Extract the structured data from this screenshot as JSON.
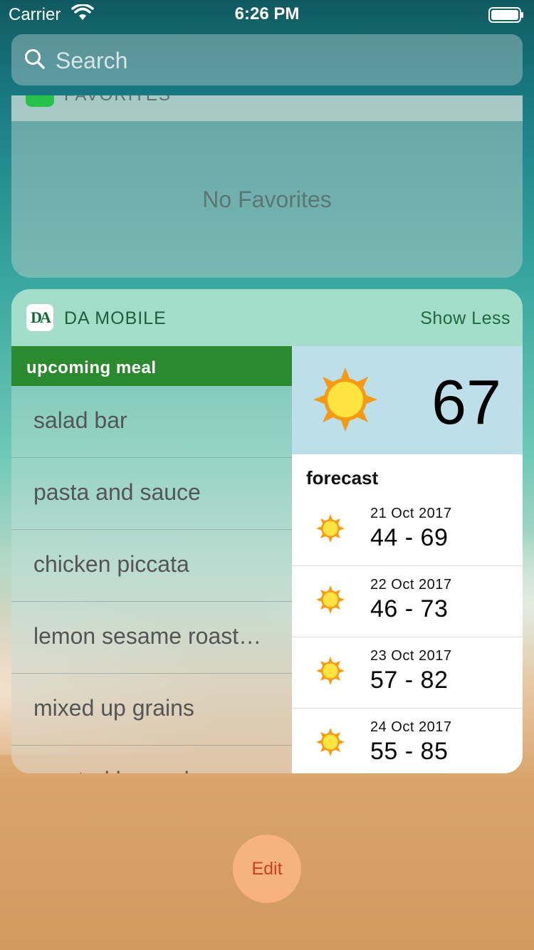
{
  "status_bar": {
    "carrier": "Carrier",
    "time": "6:26 PM"
  },
  "search": {
    "placeholder": "Search"
  },
  "favorites": {
    "title": "FAVORITES",
    "empty_text": "No Favorites"
  },
  "da_widget": {
    "logo_text": "DA",
    "title": "DA MOBILE",
    "show_less": "Show Less",
    "meal_header": "upcoming meal",
    "meals": [
      "salad bar",
      "pasta and sauce",
      "chicken piccata",
      "lemon sesame roast…",
      "mixed up grains",
      "roasted brussels sp"
    ],
    "current_temp": "67",
    "forecast_title": "forecast",
    "forecast": [
      {
        "date": "21 Oct 2017",
        "range": "44 - 69"
      },
      {
        "date": "22 Oct 2017",
        "range": "46 - 73"
      },
      {
        "date": "23 Oct 2017",
        "range": "57 - 82"
      },
      {
        "date": "24 Oct 2017",
        "range": "55 - 85"
      }
    ]
  },
  "edit_label": "Edit",
  "colors": {
    "meal_header_bg": "#2a8a2d",
    "weather_bg": "#bddfea",
    "sun_outer": "#f59a12",
    "sun_inner": "#ffe341",
    "edit_text": "#c8411b"
  }
}
